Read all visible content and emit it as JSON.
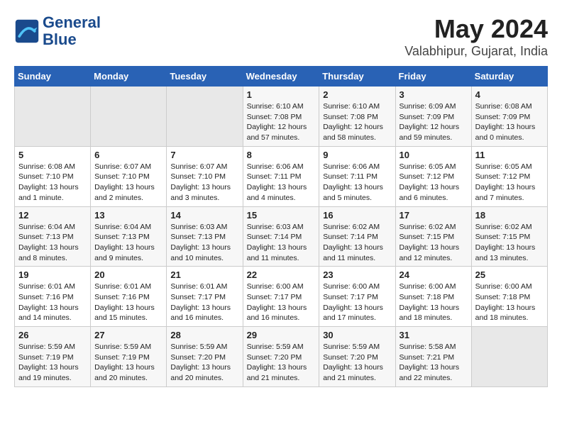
{
  "header": {
    "logo_line1": "General",
    "logo_line2": "Blue",
    "title": "May 2024",
    "subtitle": "Valabhipur, Gujarat, India"
  },
  "weekdays": [
    "Sunday",
    "Monday",
    "Tuesday",
    "Wednesday",
    "Thursday",
    "Friday",
    "Saturday"
  ],
  "weeks": [
    [
      {
        "day": "",
        "info": ""
      },
      {
        "day": "",
        "info": ""
      },
      {
        "day": "",
        "info": ""
      },
      {
        "day": "1",
        "info": "Sunrise: 6:10 AM\nSunset: 7:08 PM\nDaylight: 12 hours and 57 minutes."
      },
      {
        "day": "2",
        "info": "Sunrise: 6:10 AM\nSunset: 7:08 PM\nDaylight: 12 hours and 58 minutes."
      },
      {
        "day": "3",
        "info": "Sunrise: 6:09 AM\nSunset: 7:09 PM\nDaylight: 12 hours and 59 minutes."
      },
      {
        "day": "4",
        "info": "Sunrise: 6:08 AM\nSunset: 7:09 PM\nDaylight: 13 hours and 0 minutes."
      }
    ],
    [
      {
        "day": "5",
        "info": "Sunrise: 6:08 AM\nSunset: 7:10 PM\nDaylight: 13 hours and 1 minute."
      },
      {
        "day": "6",
        "info": "Sunrise: 6:07 AM\nSunset: 7:10 PM\nDaylight: 13 hours and 2 minutes."
      },
      {
        "day": "7",
        "info": "Sunrise: 6:07 AM\nSunset: 7:10 PM\nDaylight: 13 hours and 3 minutes."
      },
      {
        "day": "8",
        "info": "Sunrise: 6:06 AM\nSunset: 7:11 PM\nDaylight: 13 hours and 4 minutes."
      },
      {
        "day": "9",
        "info": "Sunrise: 6:06 AM\nSunset: 7:11 PM\nDaylight: 13 hours and 5 minutes."
      },
      {
        "day": "10",
        "info": "Sunrise: 6:05 AM\nSunset: 7:12 PM\nDaylight: 13 hours and 6 minutes."
      },
      {
        "day": "11",
        "info": "Sunrise: 6:05 AM\nSunset: 7:12 PM\nDaylight: 13 hours and 7 minutes."
      }
    ],
    [
      {
        "day": "12",
        "info": "Sunrise: 6:04 AM\nSunset: 7:13 PM\nDaylight: 13 hours and 8 minutes."
      },
      {
        "day": "13",
        "info": "Sunrise: 6:04 AM\nSunset: 7:13 PM\nDaylight: 13 hours and 9 minutes."
      },
      {
        "day": "14",
        "info": "Sunrise: 6:03 AM\nSunset: 7:13 PM\nDaylight: 13 hours and 10 minutes."
      },
      {
        "day": "15",
        "info": "Sunrise: 6:03 AM\nSunset: 7:14 PM\nDaylight: 13 hours and 11 minutes."
      },
      {
        "day": "16",
        "info": "Sunrise: 6:02 AM\nSunset: 7:14 PM\nDaylight: 13 hours and 11 minutes."
      },
      {
        "day": "17",
        "info": "Sunrise: 6:02 AM\nSunset: 7:15 PM\nDaylight: 13 hours and 12 minutes."
      },
      {
        "day": "18",
        "info": "Sunrise: 6:02 AM\nSunset: 7:15 PM\nDaylight: 13 hours and 13 minutes."
      }
    ],
    [
      {
        "day": "19",
        "info": "Sunrise: 6:01 AM\nSunset: 7:16 PM\nDaylight: 13 hours and 14 minutes."
      },
      {
        "day": "20",
        "info": "Sunrise: 6:01 AM\nSunset: 7:16 PM\nDaylight: 13 hours and 15 minutes."
      },
      {
        "day": "21",
        "info": "Sunrise: 6:01 AM\nSunset: 7:17 PM\nDaylight: 13 hours and 16 minutes."
      },
      {
        "day": "22",
        "info": "Sunrise: 6:00 AM\nSunset: 7:17 PM\nDaylight: 13 hours and 16 minutes."
      },
      {
        "day": "23",
        "info": "Sunrise: 6:00 AM\nSunset: 7:17 PM\nDaylight: 13 hours and 17 minutes."
      },
      {
        "day": "24",
        "info": "Sunrise: 6:00 AM\nSunset: 7:18 PM\nDaylight: 13 hours and 18 minutes."
      },
      {
        "day": "25",
        "info": "Sunrise: 6:00 AM\nSunset: 7:18 PM\nDaylight: 13 hours and 18 minutes."
      }
    ],
    [
      {
        "day": "26",
        "info": "Sunrise: 5:59 AM\nSunset: 7:19 PM\nDaylight: 13 hours and 19 minutes."
      },
      {
        "day": "27",
        "info": "Sunrise: 5:59 AM\nSunset: 7:19 PM\nDaylight: 13 hours and 20 minutes."
      },
      {
        "day": "28",
        "info": "Sunrise: 5:59 AM\nSunset: 7:20 PM\nDaylight: 13 hours and 20 minutes."
      },
      {
        "day": "29",
        "info": "Sunrise: 5:59 AM\nSunset: 7:20 PM\nDaylight: 13 hours and 21 minutes."
      },
      {
        "day": "30",
        "info": "Sunrise: 5:59 AM\nSunset: 7:20 PM\nDaylight: 13 hours and 21 minutes."
      },
      {
        "day": "31",
        "info": "Sunrise: 5:58 AM\nSunset: 7:21 PM\nDaylight: 13 hours and 22 minutes."
      },
      {
        "day": "",
        "info": ""
      }
    ]
  ]
}
